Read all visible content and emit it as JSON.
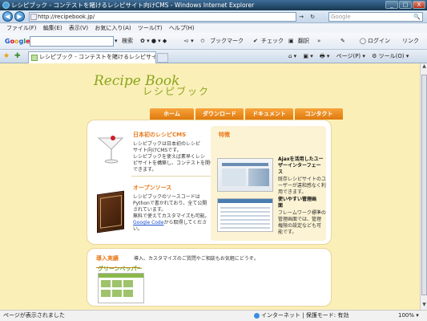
{
  "window": {
    "title": "レシピブック - コンテストを賭けるレシピサイト向けCMS - Windows Internet Explorer",
    "controls": [
      "_",
      "□",
      "X"
    ]
  },
  "address_bar": {
    "url": "http://recipebook.jp/",
    "go_glyph": "→",
    "refresh_glyph": "↻",
    "stop_glyph": "X",
    "search_placeholder": "Google",
    "search_glyph": "🔍"
  },
  "nav_glyphs": {
    "back": "◀",
    "forward": "▶"
  },
  "menu": {
    "items": [
      "ファイル(F)",
      "編集(E)",
      "表示(V)",
      "お気に入り(A)",
      "ツール(T)",
      "ヘルプ(H)"
    ]
  },
  "google_toolbar": {
    "logo": {
      "g1": "G",
      "o1": "o",
      "o2": "o",
      "g2": "g",
      "l": "l",
      "e": "e"
    },
    "search_label": "検索",
    "search_arrow": "▾",
    "icons": "✿ ▾ ● ▾ ◆",
    "arrow_item": "➪ ▾",
    "bookmark_label": "ブックマーク",
    "check_label": "チェック",
    "translate_label": "翻訳",
    "overflow": "»",
    "login_label": "ログイン",
    "link_label": "リンク"
  },
  "tabs": {
    "fav_glyph": "★",
    "add_glyph": "✚",
    "active_tab": "レシピブック - コンテストを賭けるレシピサイ..."
  },
  "command_bar": {
    "home": "⌂ ▾",
    "feeds": "▣ ▾",
    "print": "🖶 ▾",
    "page": "ページ(P) ▾",
    "tools": "⚙ ツール(O) ▾"
  },
  "page": {
    "logo_main": "Recipe Book",
    "logo_sub": "レシピブック",
    "nav": [
      "ホーム",
      "ダウンロード",
      "ドキュメント",
      "コンタクト"
    ],
    "intro": {
      "title": "日本初のレシピCMS",
      "body": [
        "レシピブックは日本初のレシピ",
        "サイト向けCMSです。",
        "レシピブックを使えば素早くレシ",
        "ピサイトを構築し、コンテストを開催",
        "できます。"
      ]
    },
    "oss": {
      "title": "オープンソース",
      "body": [
        "レシピブックのソースコードは",
        "Pythonで書かれており、全て公開",
        "されています。",
        "無料で使えてカスタマイズも可能。"
      ],
      "link": "Google Code",
      "link_suffix": "から取得してくださ",
      "body_tail": "い。"
    },
    "features": {
      "title": "特徴",
      "ajax_title": [
        "Ajaxを活用したユー",
        "ザーインターフェー",
        "ス"
      ],
      "ajax_body": [
        "既存レシピサイトのユ",
        "ーザーが違和感なく利",
        "用できます。"
      ],
      "admin_title": [
        "使いやすい管理画",
        "面"
      ],
      "admin_body": [
        "フレームワーク標準の",
        "管理画面では、管理",
        "権限の設定なども可",
        "能です。"
      ]
    },
    "showcase": {
      "title": "導入実績",
      "text": "導入、カスタマイズのご質問やご相談もお気軽にどうぞ。",
      "site_name": "グリーンペッパー"
    }
  },
  "scrollbar": {
    "up": "▲",
    "down": "▼"
  },
  "status_bar": {
    "text": "ページが表示されました",
    "zone": "インターネット | 保護モード: 有効",
    "zoom": "100% ▾"
  }
}
